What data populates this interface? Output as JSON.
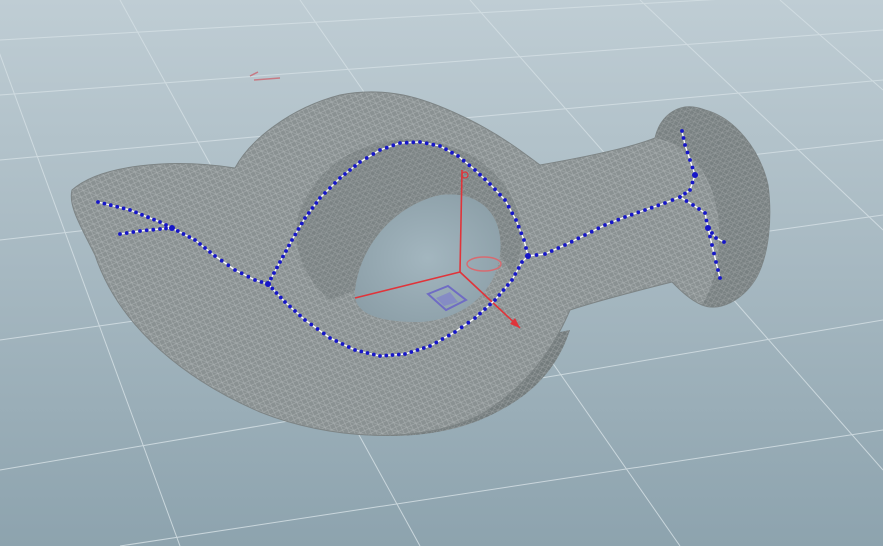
{
  "scene": {
    "background_top": "#b9c8d0",
    "background_bottom": "#8fa5b0",
    "grid_color": "#d6e0e5",
    "mesh_fill": "#8c9394",
    "mesh_wire": "#b3b9ba",
    "mesh_dark": "#6e7677",
    "skeleton_point_color": "#1616c8",
    "skeleton_edge_color": "#ffffff",
    "gizmo_axis_color": "#e0343a",
    "gizmo_plane_color": "#6f6cc4"
  },
  "icons": {
    "origin": "origin-marker-icon",
    "gizmo": "transform-handle-icon"
  }
}
